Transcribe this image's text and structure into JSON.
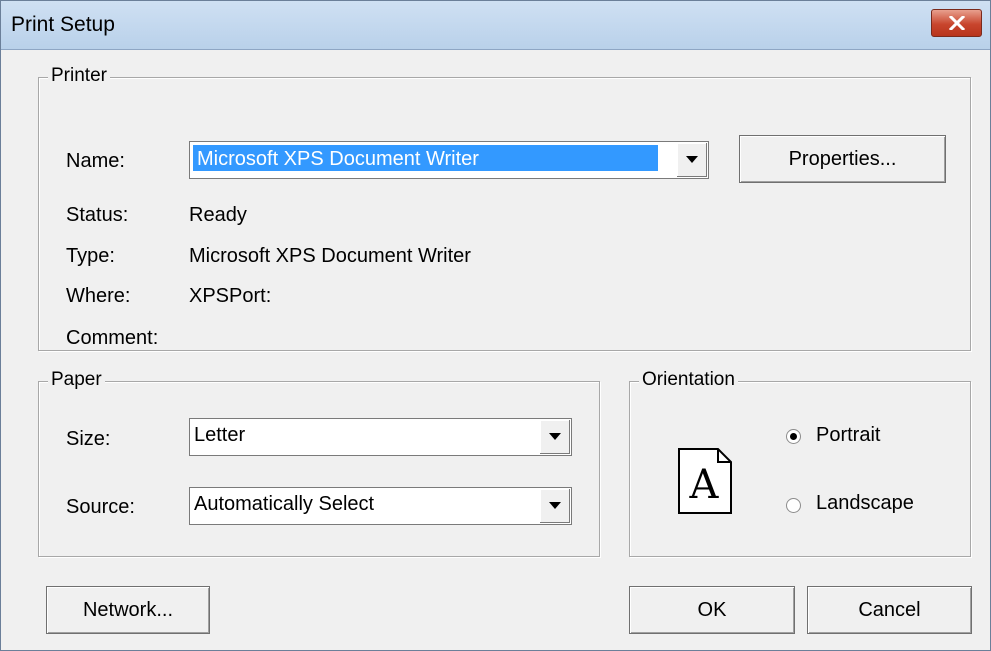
{
  "window": {
    "title": "Print Setup"
  },
  "printer": {
    "legend": "Printer",
    "name_label": "Name:",
    "name_value": "Microsoft XPS Document Writer",
    "properties_label": "Properties...",
    "status_label": "Status:",
    "status_value": "Ready",
    "type_label": "Type:",
    "type_value": "Microsoft XPS Document Writer",
    "where_label": "Where:",
    "where_value": "XPSPort:",
    "comment_label": "Comment:"
  },
  "paper": {
    "legend": "Paper",
    "size_label": "Size:",
    "size_value": "Letter",
    "source_label": "Source:",
    "source_value": "Automatically Select"
  },
  "orientation": {
    "legend": "Orientation",
    "preview_letter": "A",
    "portrait_label": "Portrait",
    "landscape_label": "Landscape",
    "selected": "Portrait"
  },
  "buttons": {
    "network_label": "Network...",
    "ok_label": "OK",
    "cancel_label": "Cancel"
  },
  "icons": {
    "close": "close-icon",
    "dropdown": "chevron-down-icon",
    "page": "portrait-page-icon"
  }
}
